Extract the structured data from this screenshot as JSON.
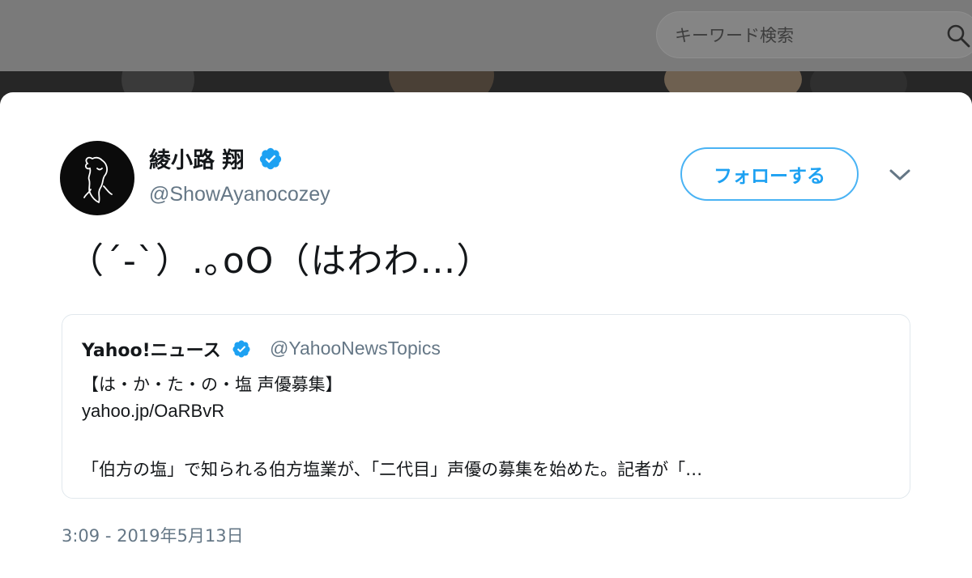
{
  "search": {
    "placeholder": "キーワード検索"
  },
  "tweet": {
    "display_name": "綾小路 翔",
    "handle": "@ShowAyanocozey",
    "follow_label": "フォローする",
    "text": "（´-`）.｡oO（はわわ…）",
    "timestamp": "3:09 - 2019年5月13日"
  },
  "quoted_tweet": {
    "display_name": "Yahoo!ニュース",
    "handle": "@YahooNewsTopics",
    "line1": "【は・か・た・の・塩 声優募集】",
    "link": "yahoo.jp/OaRBvR",
    "body": "「伯方の塩」で知られる伯方塩業が、「二代目」声優の募集を始めた。記者が「…"
  },
  "colors": {
    "accent": "#1da1f2",
    "verified": "#1da1f2",
    "text_primary": "#14171a",
    "text_secondary": "#657786",
    "overlay": "#6b6b6b"
  }
}
